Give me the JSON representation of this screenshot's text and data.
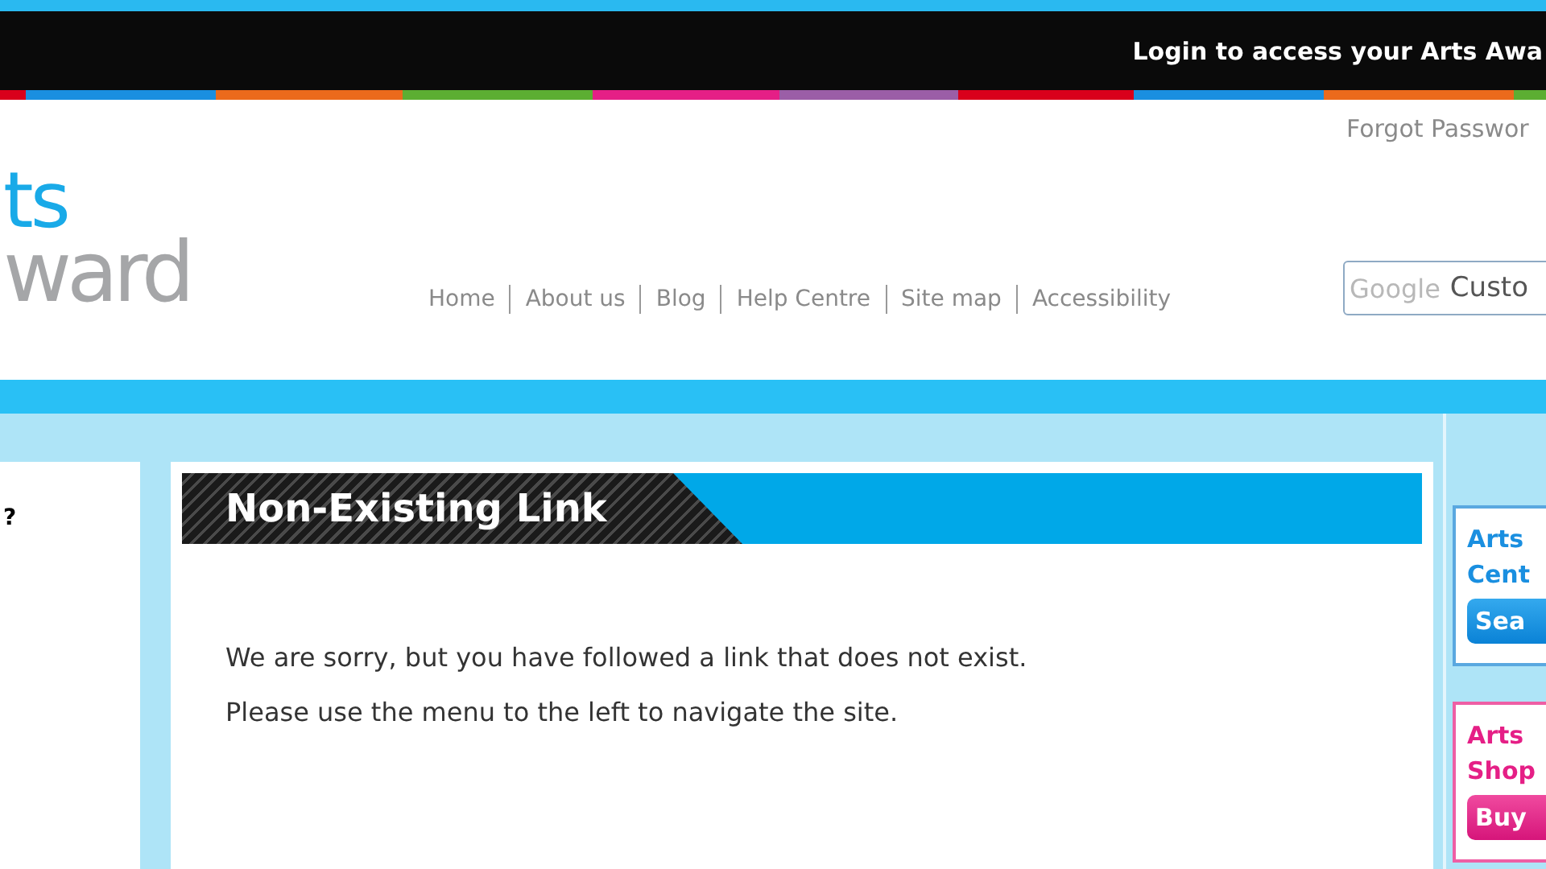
{
  "topbar": {
    "login_text": "Login to access your Arts Awa"
  },
  "header": {
    "forgot_link": "Forgot Passwor",
    "logo_top": "ts",
    "logo_bottom": "ward",
    "nav": [
      "Home",
      "About us",
      "Blog",
      "Help Centre",
      "Site map",
      "Accessibility"
    ],
    "search": {
      "brand": "Google",
      "placeholder": "Custo"
    }
  },
  "left_panel": {
    "text": "?"
  },
  "main": {
    "title": "Non-Existing Link",
    "paragraphs": [
      "We are sorry, but you have followed a link that does not exist.",
      "Please use the menu to the left to navigate the site."
    ]
  },
  "promos": [
    {
      "kind": "blue",
      "lines": [
        "Arts",
        "Cent"
      ],
      "button": "Sea"
    },
    {
      "kind": "pink",
      "lines": [
        "Arts",
        "Shop"
      ],
      "button": "Buy"
    }
  ]
}
